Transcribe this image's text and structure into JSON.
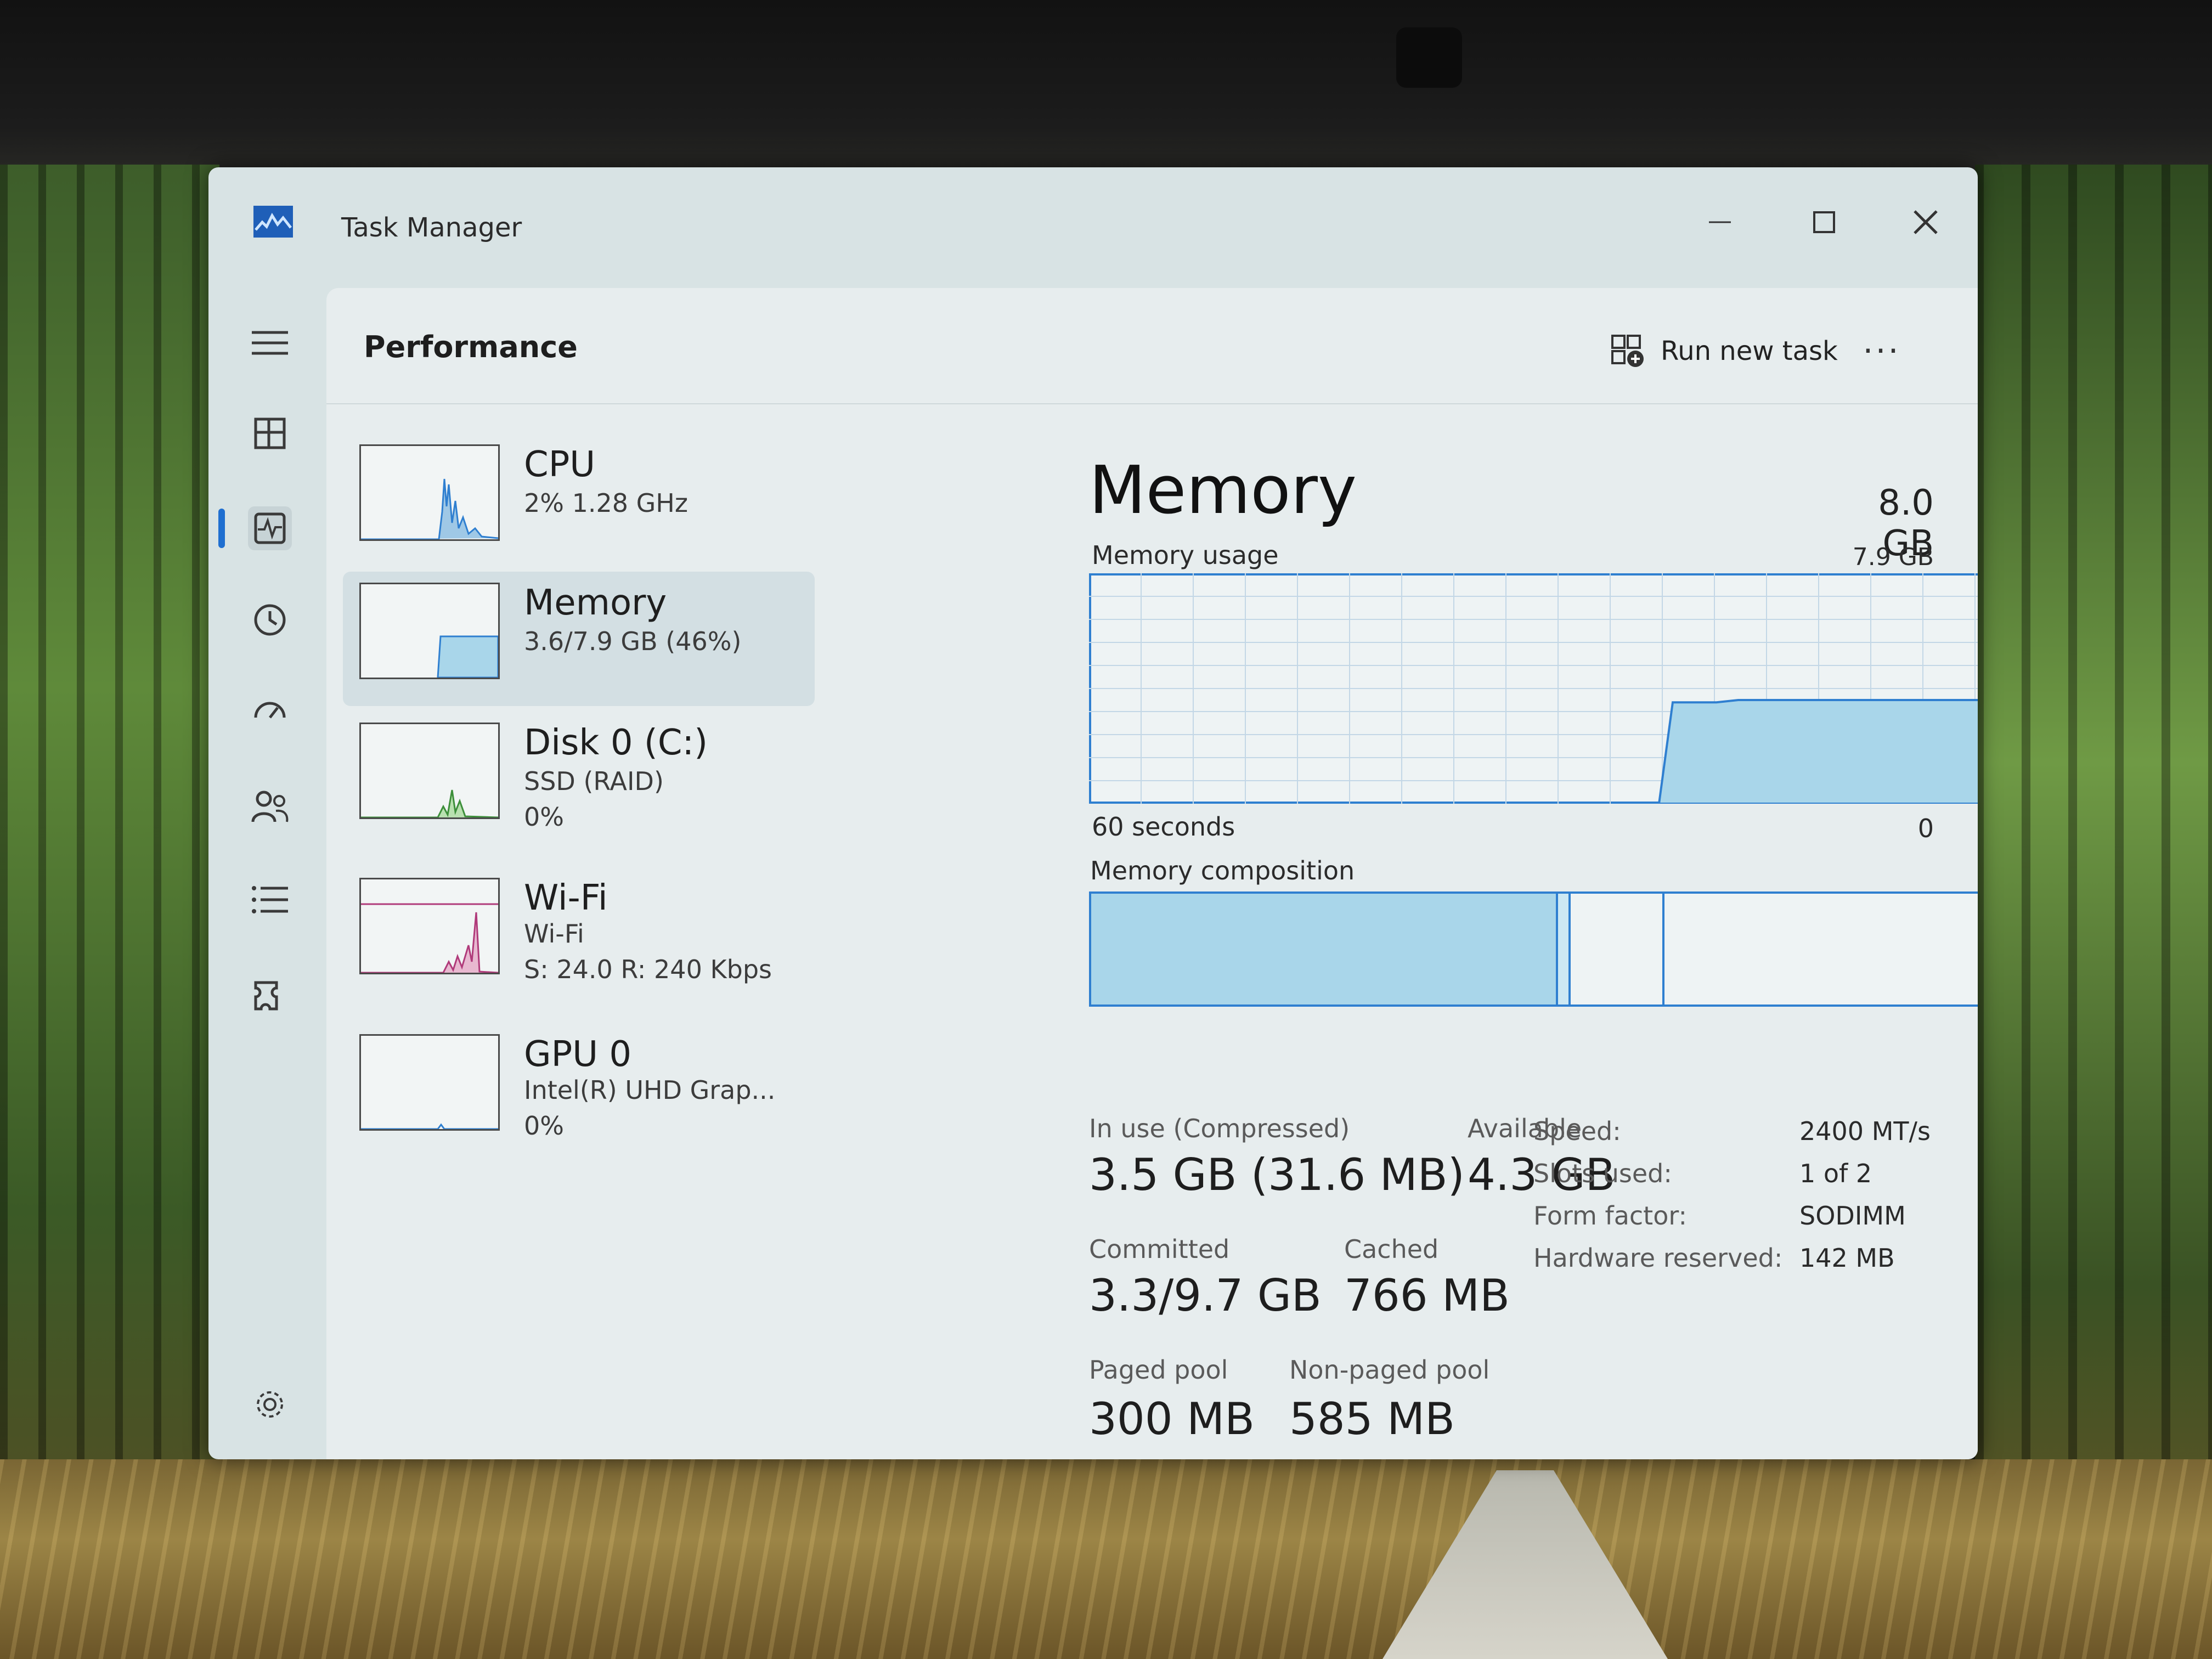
{
  "window": {
    "title": "Task Manager",
    "controls": {
      "minimize": "minimize-icon",
      "maximize": "maximize-icon",
      "close": "close-icon"
    }
  },
  "nav": {
    "items": [
      {
        "name": "hamburger-menu",
        "icon": "hamburger-icon"
      },
      {
        "name": "processes",
        "icon": "processes-icon"
      },
      {
        "name": "performance",
        "icon": "performance-icon",
        "active": true
      },
      {
        "name": "app-history",
        "icon": "history-icon"
      },
      {
        "name": "startup-apps",
        "icon": "startup-icon"
      },
      {
        "name": "users",
        "icon": "users-icon"
      },
      {
        "name": "details",
        "icon": "details-icon"
      },
      {
        "name": "services",
        "icon": "services-icon"
      },
      {
        "name": "settings",
        "icon": "gear-icon"
      }
    ]
  },
  "header": {
    "title": "Performance",
    "run_new_task": "Run new task",
    "more": "···"
  },
  "resources": [
    {
      "name": "CPU",
      "line1": "2%  1.28 GHz",
      "line2": ""
    },
    {
      "name": "Memory",
      "line1": "3.6/7.9 GB (46%)",
      "line2": "",
      "selected": true
    },
    {
      "name": "Disk 0 (C:)",
      "line1": "SSD (RAID)",
      "line2": "0%"
    },
    {
      "name": "Wi-Fi",
      "line1": "Wi-Fi",
      "line2": "S: 24.0  R: 240 Kbps"
    },
    {
      "name": "GPU 0",
      "line1": "Intel(R) UHD Grap...",
      "line2": "0%"
    }
  ],
  "memory": {
    "heading": "Memory",
    "total": "8.0 GB",
    "usage_label": "Memory usage",
    "usage_max": "7.9 GB",
    "x_left": "60 seconds",
    "x_right": "0",
    "composition_label": "Memory composition",
    "usage_history": {
      "points_from_now": [
        0.46,
        0.46,
        0.46,
        0.46,
        0.46,
        0.46,
        0.45,
        0.45,
        0.45,
        0.45,
        0.45,
        0.45,
        0.45,
        0.45,
        0.45,
        0.45,
        0.45,
        0.45,
        0.45,
        0.44,
        0.44,
        0.44
      ],
      "filled_fraction_of_window": 0.44
    },
    "composition": {
      "in_use": 0.45,
      "modified": 0.01,
      "standby": 0.09
    },
    "stats": {
      "in_use_label": "In use (Compressed)",
      "in_use_value": "3.5 GB (31.6 MB)",
      "available_label": "Available",
      "available_value": "4.3 GB",
      "committed_label": "Committed",
      "committed_value": "3.3/9.7 GB",
      "cached_label": "Cached",
      "cached_value": "766 MB",
      "paged_label": "Paged pool",
      "paged_value": "300 MB",
      "nonpaged_label": "Non-paged pool",
      "nonpaged_value": "585 MB"
    },
    "specs": [
      {
        "key": "Speed:",
        "value": "2400 MT/s"
      },
      {
        "key": "Slots used:",
        "value": "1 of 2"
      },
      {
        "key": "Form factor:",
        "value": "SODIMM"
      },
      {
        "key": "Hardware reserved:",
        "value": "142 MB"
      }
    ]
  },
  "colors": {
    "accent": "#2f7fd0",
    "graph_fill": "#a9d6ea",
    "wifi_line": "#b03a7a"
  }
}
